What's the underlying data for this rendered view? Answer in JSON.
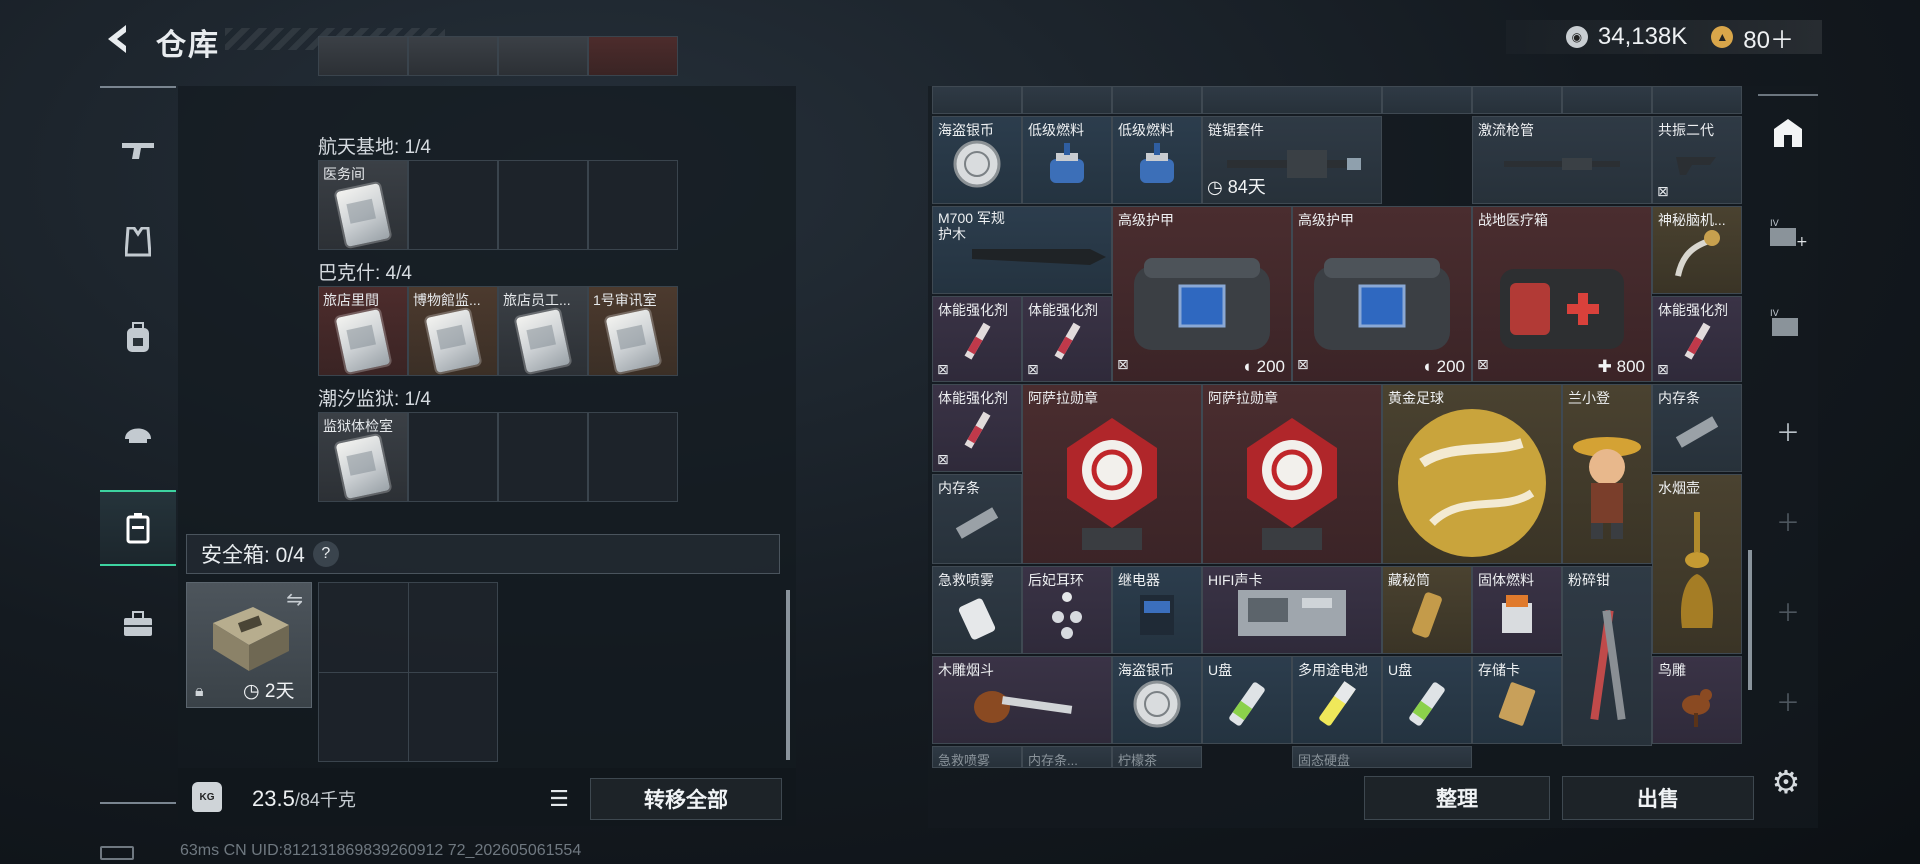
{
  "header": {
    "title": "仓库",
    "currency": [
      {
        "icon": "silver-coin-icon",
        "value": "34,138K"
      },
      {
        "icon": "gold-coin-icon",
        "value": "80＋"
      }
    ]
  },
  "sidebar": {
    "items": [
      {
        "name": "weapon-icon"
      },
      {
        "name": "armor-vest-icon"
      },
      {
        "name": "backpack-icon"
      },
      {
        "name": "helmet-icon"
      },
      {
        "name": "case-icon",
        "active": true
      },
      {
        "name": "briefcase-icon"
      }
    ]
  },
  "left_containers": {
    "groups": [
      {
        "label": "航天基地: 1/4",
        "cells": [
          "医务间",
          "",
          "",
          ""
        ]
      },
      {
        "label": "巴克什: 4/4",
        "cells": [
          "旅店里間",
          "博物館监...",
          "旅店员工...",
          "1号审讯室"
        ]
      },
      {
        "label": "潮汐监狱: 1/4",
        "cells": [
          "监狱体检室",
          "",
          "",
          ""
        ]
      }
    ],
    "safe_box": {
      "label": "安全箱: 0/4",
      "help": "?",
      "timer": "2天"
    }
  },
  "bottom": {
    "weight_value": "23.5",
    "weight_max": "/84千克",
    "transfer_label": "转移全部",
    "sort_label": "整理",
    "sell_label": "出售"
  },
  "status": "63ms  CN UID:812131869839260912 72_202605061554",
  "inventory": {
    "items": [
      {
        "name": "海盗银币"
      },
      {
        "name": "低级燃料"
      },
      {
        "name": "低级燃料"
      },
      {
        "name": "链锯套件",
        "badge": "84天"
      },
      {
        "name": "激流枪管"
      },
      {
        "name": "共振二代"
      },
      {
        "name": "M700 军规护木"
      },
      {
        "name": "高级护甲",
        "badge": "200"
      },
      {
        "name": "高级护甲",
        "badge": "200"
      },
      {
        "name": "战地医疗箱",
        "badge": "800"
      },
      {
        "name": "神秘脑机..."
      },
      {
        "name": "体能强化剂"
      },
      {
        "name": "体能强化剂"
      },
      {
        "name": "体能强化剂"
      },
      {
        "name": "体能强化剂"
      },
      {
        "name": "阿萨拉勋章"
      },
      {
        "name": "阿萨拉勋章"
      },
      {
        "name": "黄金足球"
      },
      {
        "name": "兰小登"
      },
      {
        "name": "内存条"
      },
      {
        "name": "内存条"
      },
      {
        "name": "水烟壶"
      },
      {
        "name": "急救喷雾"
      },
      {
        "name": "后妃耳环"
      },
      {
        "name": "继电器"
      },
      {
        "name": "HIFI声卡"
      },
      {
        "name": "藏秘筒"
      },
      {
        "name": "固体燃料"
      },
      {
        "name": "粉碎钳"
      },
      {
        "name": "木雕烟斗"
      },
      {
        "name": "海盗银币"
      },
      {
        "name": "U盘"
      },
      {
        "name": "多用途电池"
      },
      {
        "name": "U盘"
      },
      {
        "name": "存储卡"
      },
      {
        "name": "鸟雕"
      },
      {
        "name": "急救喷雾"
      },
      {
        "name": "内存条..."
      },
      {
        "name": "柠檬茶"
      },
      {
        "name": "固态硬盘"
      }
    ]
  },
  "colors": {
    "accent": "#3dd3a0",
    "red_rarity": "#4a2d2f",
    "gold_rarity": "#4a4230"
  }
}
